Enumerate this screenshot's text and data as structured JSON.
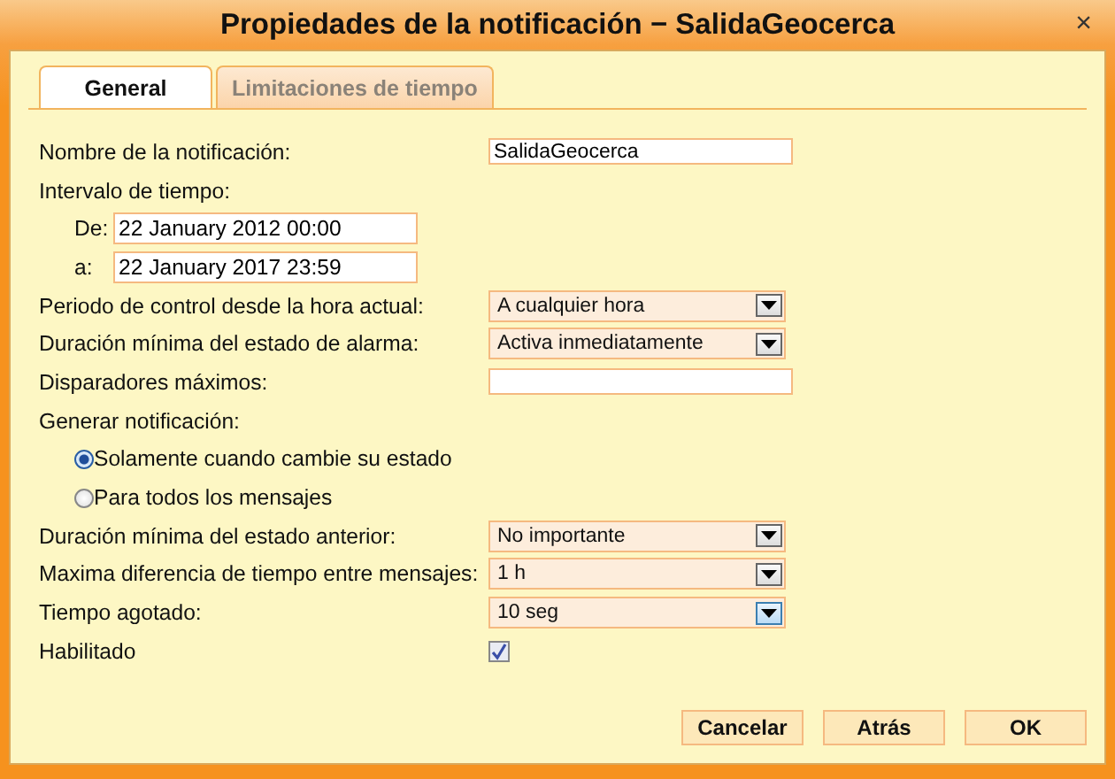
{
  "window": {
    "title": "Propiedades de la notificación − SalidaGeocerca",
    "close": "×"
  },
  "tabs": [
    {
      "label": "General",
      "selected": true
    },
    {
      "label": "Limitaciones de tiempo",
      "selected": false
    }
  ],
  "rows": [
    {
      "kind": "text",
      "label": "Nombre de la notificación:",
      "value": "SalidaGeocerca"
    },
    {
      "kind": "heading",
      "label": "Intervalo de tiempo:"
    },
    {
      "kind": "date",
      "label": "De:",
      "value": "22 January 2012 00:00"
    },
    {
      "kind": "date",
      "label": "a:",
      "value": "22 January 2017 23:59"
    },
    {
      "kind": "select",
      "label": "Periodo de control desde la hora actual:",
      "value": "A cualquier hora",
      "focused": false
    },
    {
      "kind": "select",
      "label": "Duración mínima del estado de alarma:",
      "value": "Activa inmediatamente",
      "focused": false
    },
    {
      "kind": "text",
      "label": "Disparadores máximos:"
    },
    {
      "kind": "heading",
      "label": "Generar notificación:"
    },
    {
      "kind": "radio",
      "label": "Solamente cuando cambie su estado",
      "selected": true
    },
    {
      "kind": "radio",
      "label": "Para todos los mensajes",
      "selected": false
    },
    {
      "kind": "select",
      "label": "Duración mínima del estado anterior:",
      "value": "No importante",
      "focused": false
    },
    {
      "kind": "select",
      "label": "Maxima diferencia de tiempo entre mensajes:",
      "value": "1 h",
      "focused": false
    },
    {
      "kind": "select",
      "label": "Tiempo agotado:",
      "value": "10 seg",
      "focused": true
    },
    {
      "kind": "checkbox",
      "label": "Habilitado",
      "checked": true
    }
  ],
  "buttons": [
    "Cancelar",
    "Atrás",
    "OK"
  ]
}
